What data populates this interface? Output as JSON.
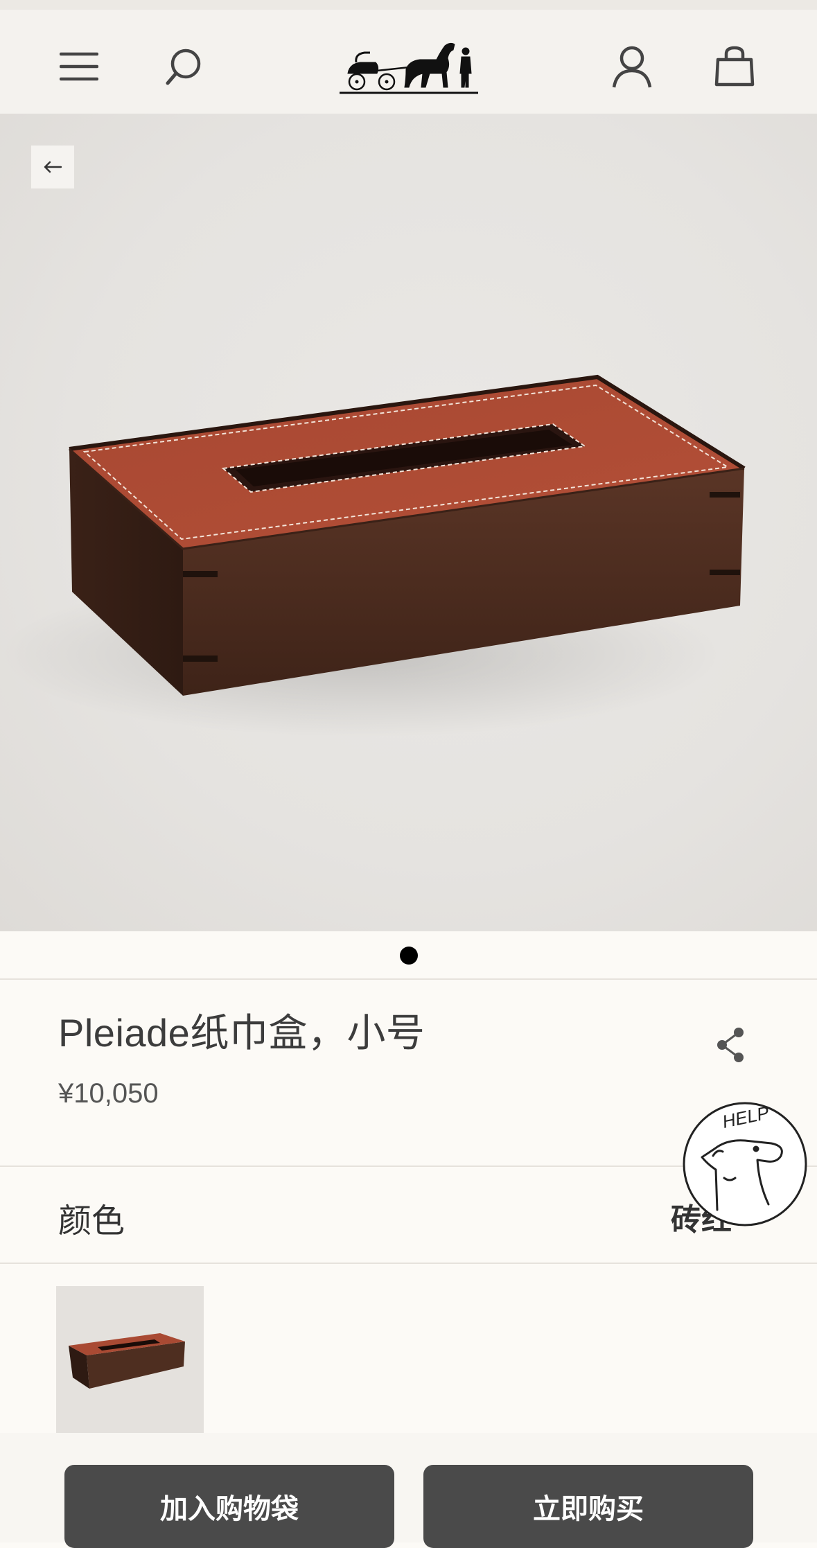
{
  "header": {
    "menu_icon": "hamburger-menu-icon",
    "search_icon": "search-icon",
    "logo_icon": "horse-carriage-logo",
    "account_icon": "user-icon",
    "bag_icon": "shopping-bag-icon"
  },
  "gallery": {
    "back_icon": "arrow-left-icon",
    "page_indicator": {
      "current": 1,
      "total": 1
    }
  },
  "product": {
    "title": "Pleiade纸巾盒，小号",
    "price": "¥10,050"
  },
  "color_section": {
    "label": "颜色",
    "selected_value": "砖红"
  },
  "help_badge": {
    "text": "HELP"
  },
  "actions": {
    "add_to_bag": "加入购物袋",
    "buy_now": "立即购买"
  },
  "colors": {
    "leather": "#a94a33",
    "wood": "#4b2c20",
    "button": "#4a4a4a",
    "background": "#fcfaf6"
  }
}
